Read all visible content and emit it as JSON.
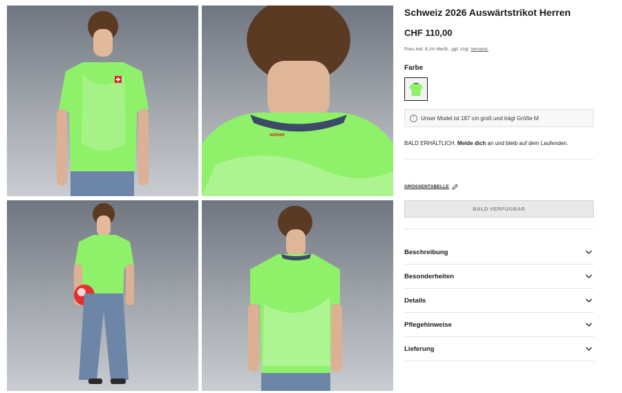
{
  "product": {
    "title": "Schweiz 2026 Auswärtstrikot Herren",
    "price": "CHF 110,00",
    "tax_note": "Preis inkl. 8.1% MwSt., ggf. zzgl.",
    "shipping_link": "Versand."
  },
  "color": {
    "label": "Farbe"
  },
  "model_note": "Unser Model ist 187 cm groß und trägt Größe M",
  "availability": {
    "prefix": "BALD ERHÄLTLICH.",
    "cta": "Melde dich",
    "suffix": "an und bleib auf dem Laufenden."
  },
  "size_table": "GRÖSSENTABELLE",
  "notify_button": "BALD VERFÜGBAR",
  "accordion": [
    {
      "label": "Beschreibung"
    },
    {
      "label": "Besonderheiten"
    },
    {
      "label": "Details"
    },
    {
      "label": "Pflegehinweise"
    },
    {
      "label": "Lieferung"
    }
  ],
  "jersey": {
    "crest_text": "suisse"
  },
  "colors": {
    "jersey_green": "#8ff06a",
    "jersey_light": "#c8f7b4",
    "collar_navy": "#3b4a66",
    "denim": "#6d86a8",
    "text": "#191919"
  },
  "icons": [
    "info-icon",
    "pencil-icon",
    "chevron-down-icon"
  ]
}
